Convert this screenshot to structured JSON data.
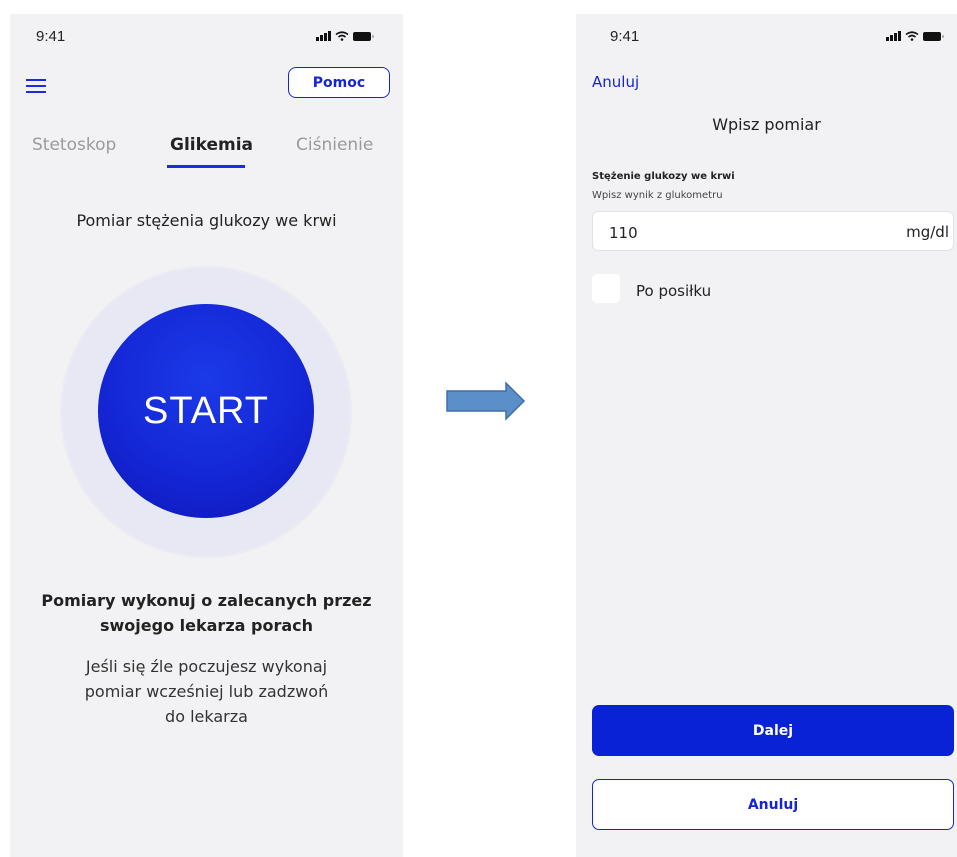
{
  "left_screen": {
    "status": {
      "time": "9:41"
    },
    "help_label": "Pomoc",
    "tabs": [
      {
        "label": "Stetoskop",
        "active": false
      },
      {
        "label": "Glikemia",
        "active": true
      },
      {
        "label": "Ciśnienie",
        "active": false
      }
    ],
    "heading": "Pomiar stężenia glukozy we krwi",
    "start_label": "START",
    "advice_bold": [
      "Pomiary wykonuj o zalecanych przez",
      "swojego lekarza porach"
    ],
    "advice_normal": [
      "Jeśli się źle poczujesz wykonaj",
      "pomiar wcześniej lub zadzwoń",
      "do lekarza"
    ]
  },
  "right_screen": {
    "status": {
      "time": "9:41"
    },
    "cancel_link": "Anuluj",
    "title": "Wpisz pomiar",
    "field_label": "Stężenie glukozy we krwi",
    "field_hint": "Wpisz wynik z glukometru",
    "input_value": "110",
    "input_unit": "mg/dl",
    "checkbox_label": "Po posiłku",
    "next_label": "Dalej",
    "cancel_label": "Anuluj"
  },
  "colors": {
    "accent": "#1624d6",
    "background": "#f2f2f4",
    "arrow": "#5b8fc9"
  }
}
